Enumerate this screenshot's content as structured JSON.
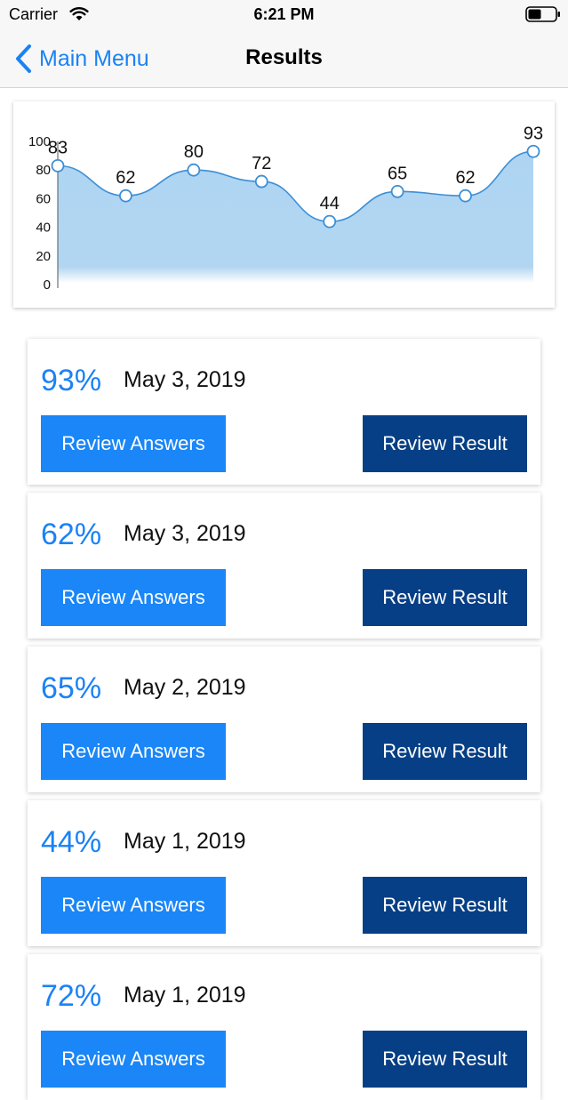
{
  "status_bar": {
    "carrier": "Carrier",
    "time": "6:21 PM"
  },
  "nav": {
    "back_label": "Main Menu",
    "title": "Results"
  },
  "colors": {
    "accent": "#1a82f5",
    "answers_button": "#1a86f7",
    "result_button": "#063f85",
    "chart_line": "#3d8fd6",
    "chart_fill": "#a9d2f1"
  },
  "chart_data": {
    "type": "area",
    "y_ticks": [
      "0",
      "20",
      "40",
      "60",
      "80",
      "100"
    ],
    "values": [
      83,
      62,
      80,
      72,
      44,
      65,
      62,
      93
    ],
    "ylim": [
      0,
      100
    ],
    "grid": false
  },
  "results": [
    {
      "score": "93%",
      "date": "May 3, 2019",
      "answers_label": "Review Answers",
      "result_label": "Review Result"
    },
    {
      "score": "62%",
      "date": "May 3, 2019",
      "answers_label": "Review Answers",
      "result_label": "Review Result"
    },
    {
      "score": "65%",
      "date": "May 2, 2019",
      "answers_label": "Review Answers",
      "result_label": "Review Result"
    },
    {
      "score": "44%",
      "date": "May 1, 2019",
      "answers_label": "Review Answers",
      "result_label": "Review Result"
    },
    {
      "score": "72%",
      "date": "May 1, 2019",
      "answers_label": "Review Answers",
      "result_label": "Review Result"
    }
  ]
}
